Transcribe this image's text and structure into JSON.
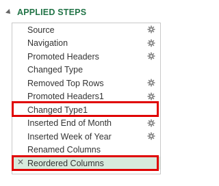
{
  "panel": {
    "title": "APPLIED STEPS"
  },
  "steps": [
    {
      "label": "Source",
      "has_settings": true
    },
    {
      "label": "Navigation",
      "has_settings": true
    },
    {
      "label": "Promoted Headers",
      "has_settings": true
    },
    {
      "label": "Changed Type",
      "has_settings": false
    },
    {
      "label": "Removed Top Rows",
      "has_settings": true
    },
    {
      "label": "Promoted Headers1",
      "has_settings": true
    },
    {
      "label": "Changed Type1",
      "has_settings": false,
      "highlighted": true
    },
    {
      "label": "Inserted End of Month",
      "has_settings": true
    },
    {
      "label": "Inserted Week of Year",
      "has_settings": true
    },
    {
      "label": "Renamed Columns",
      "has_settings": false
    },
    {
      "label": "Reordered Columns",
      "has_settings": false,
      "selected": true,
      "highlighted": true
    }
  ],
  "colors": {
    "title": "#217346",
    "selection": "#d7eadc",
    "highlight_box": "#e00000"
  },
  "icons": {
    "settings": "gear-icon",
    "delete": "close-icon",
    "collapse": "collapse-triangle-icon"
  }
}
